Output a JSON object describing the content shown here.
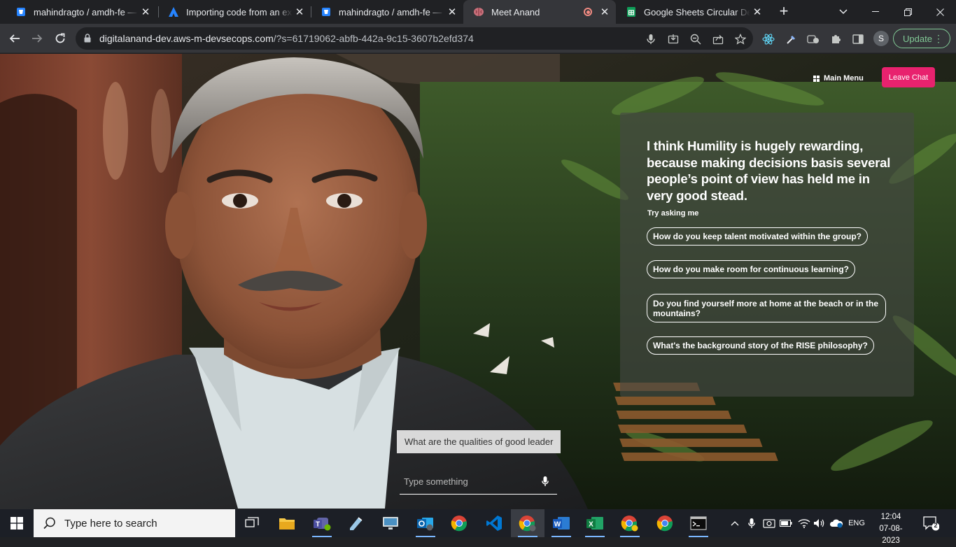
{
  "browser": {
    "tabs": [
      {
        "title": "mahindragto / amdh-fe — Bitbucket",
        "icon": "bitbucket-icon",
        "active": false
      },
      {
        "title": "Importing code from an existing project",
        "icon": "atlassian-icon",
        "active": false
      },
      {
        "title": "mahindragto / amdh-fe — Bitbucket",
        "icon": "bitbucket-icon",
        "active": false
      },
      {
        "title": "Meet Anand",
        "icon": "brain-icon",
        "active": true
      },
      {
        "title": "Google Sheets Circular Dependency",
        "icon": "sheets-icon",
        "active": false
      }
    ],
    "new_tab": "+",
    "url_host": "digitalanand-dev.aws-m-devsecops.com",
    "url_path": "/?s=61719062-abfb-442a-9c15-3607b2efd374",
    "profile_initial": "S",
    "update_label": "Update"
  },
  "page": {
    "main_menu_label": "Main Menu",
    "leave_chat_label": "Leave Chat",
    "answer_text": "I think Humility is hugely rewarding, because making decisions basis several people’s point of view has held me in very good stead.",
    "try_asking_label": "Try asking me",
    "suggestions": [
      "How do you keep talent motivated within the group?",
      "How do you make room for continuous learning?",
      "Do you find yourself more at home at the beach or in the mountains?",
      "What's the background story of the RISE philosophy?"
    ],
    "user_message": "What are the qualities of good leader",
    "input_placeholder": "Type something",
    "accent_color": "#e8226e"
  },
  "taskbar": {
    "search_placeholder": "Type here to search",
    "language": "ENG",
    "time": "12:04",
    "date": "07-08-2023",
    "notification_count": "2"
  }
}
